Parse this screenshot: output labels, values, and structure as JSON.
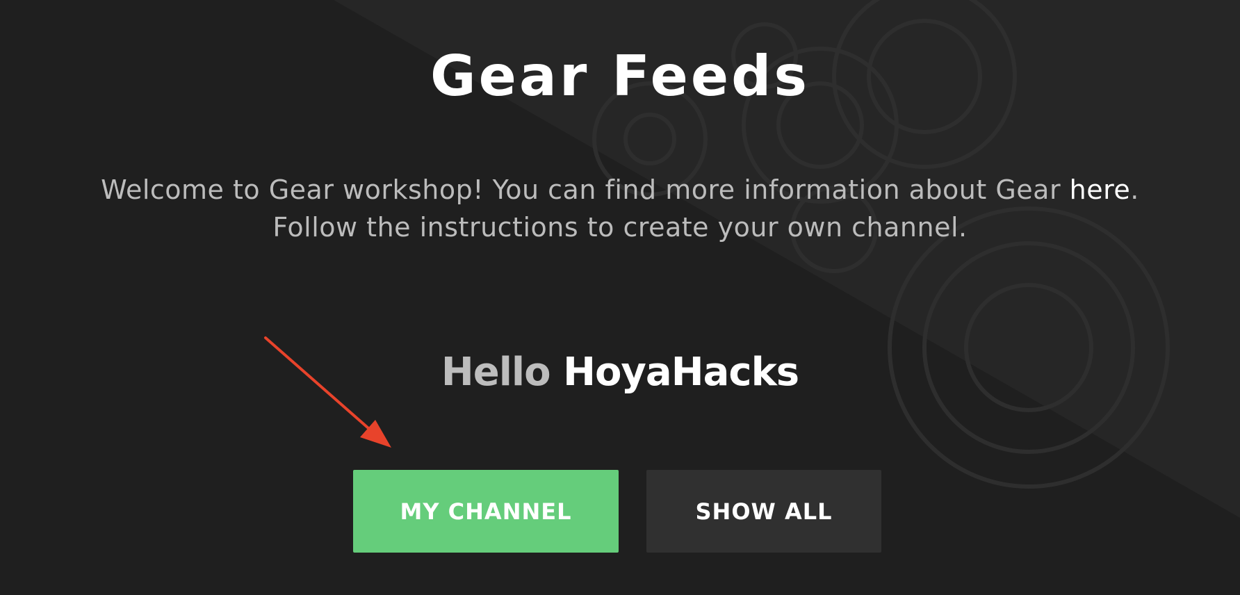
{
  "header": {
    "title": "Gear Feeds"
  },
  "intro": {
    "line1_prefix": "Welcome to Gear workshop! You can find more information about Gear ",
    "link_label": "here",
    "line1_suffix": ".",
    "line2": "Follow the instructions to create your own channel."
  },
  "greeting": {
    "hello": "Hello",
    "name": "HoyaHacks"
  },
  "actions": {
    "primary_label": "MY CHANNEL",
    "secondary_label": "SHOW ALL"
  },
  "colors": {
    "background": "#1f1f1f",
    "accent_green": "#65cd7b",
    "arrow_red": "#e8432b",
    "secondary_button": "#303030"
  },
  "icons": {
    "annotation": "arrow-icon",
    "background": "gears-pattern-icon"
  }
}
